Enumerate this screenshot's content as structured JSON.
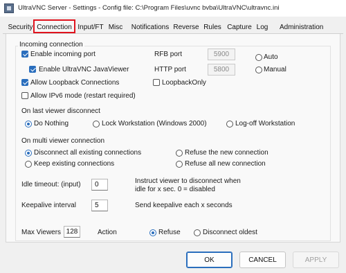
{
  "window": {
    "title": "UltraVNC Server - Settings - Config file: C:\\Program Files\\uvnc bvba\\UltraVNC\\ultravnc.ini",
    "icon": "ultravnc-app-icon"
  },
  "tabs": [
    "Security",
    "Connection",
    "Input/FT",
    "Misc",
    "Notifications",
    "Reverse",
    "Rules",
    "Capture",
    "Log",
    "Administration"
  ],
  "active_tab": "Connection",
  "highlight_color": "#e0141e",
  "incoming": {
    "legend": "Incoming connection",
    "enable_incoming": "Enable incoming port",
    "enable_java": "Enable UltraVNC JavaViewer",
    "allow_loopback": "Allow Loopback Connections",
    "allow_ipv6": "Allow IPv6 mode (restart required)",
    "rfb_label": "RFB port",
    "rfb_value": "5900",
    "http_label": "HTTP port",
    "http_value": "5800",
    "auto": "Auto",
    "manual": "Manual",
    "loopback_only": "LoopbackOnly"
  },
  "last_disconnect": {
    "heading": "On last viewer disconnect",
    "do_nothing": "Do Nothing",
    "lock": "Lock Workstation (Windows 2000)",
    "logoff": "Log-off Workstation"
  },
  "multi_viewer": {
    "heading": "On multi viewer connection",
    "disconnect_all": "Disconnect all existing connections",
    "keep_existing": "Keep existing connections",
    "refuse_new": "Refuse the new connection",
    "refuse_all": "Refuse all new connection"
  },
  "idle": {
    "label": "Idle timeout: (input)",
    "value": "0",
    "desc1": "Instruct viewer to disconnect when",
    "desc2": "idle for x sec.  0 = disabled"
  },
  "keepalive": {
    "label": "Keepalive interval",
    "value": "5",
    "desc": "Send keepalive each x seconds"
  },
  "max_viewers": {
    "label": "Max Viewers",
    "value": "128",
    "action": "Action",
    "refuse": "Refuse",
    "disconnect_oldest": "Disconnect oldest"
  },
  "buttons": {
    "ok": "OK",
    "cancel": "CANCEL",
    "apply": "APPLY"
  }
}
